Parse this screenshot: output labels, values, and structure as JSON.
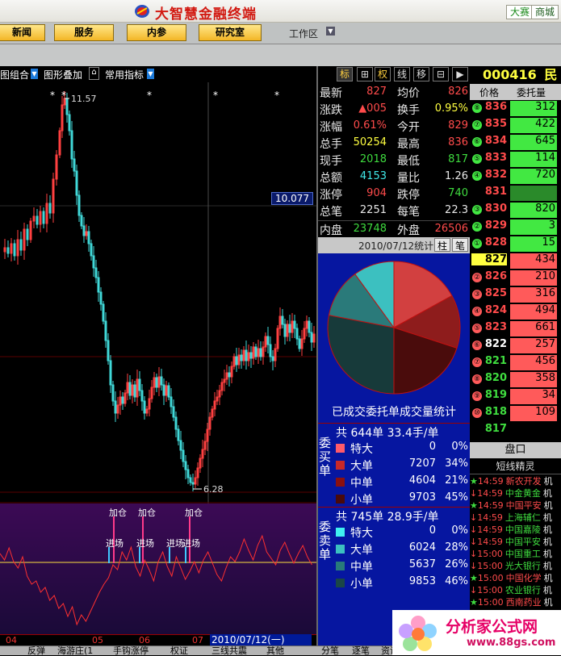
{
  "app": {
    "title": "大智慧金融终端",
    "btn_dasai": "大赛",
    "btn_shangcheng": "商城"
  },
  "menu": {
    "items": [
      "新闻",
      "服务",
      "内参",
      "研究室"
    ],
    "workzone": "工作区"
  },
  "toolbar": {
    "combo": "图组合",
    "overlay": "图形叠加",
    "indicator": "常用指标"
  },
  "chart": {
    "high_label": "11.57",
    "low_label": "6.28",
    "price_tag": "10.077",
    "signals": [
      "加仓",
      "加仓",
      "加仓",
      "进场",
      "进场",
      "进场",
      "进场"
    ],
    "x_ticks": [
      "04",
      "05",
      "06",
      "07"
    ],
    "date_label": "2010/07/12(一)"
  },
  "chart_data": {
    "type": "candlestick",
    "high": 11.57,
    "low": 6.28,
    "price_marker": 10.077,
    "x_labels": [
      "04",
      "05",
      "06",
      "07"
    ],
    "date": "2010/07/12(一)"
  },
  "bottom_tabs": [
    "反弹",
    "海游庄(1",
    "手钩涨停",
    "权证",
    "三线共震",
    "其他"
  ],
  "bottom_tabs_right": [
    "分笔",
    "逐笔",
    "资讯"
  ],
  "right_tools": [
    "标",
    "⊞",
    "权",
    "线",
    "移",
    "⊟",
    "▶"
  ],
  "stock": {
    "code": "000416",
    "name": "民生"
  },
  "quote": {
    "rows": [
      {
        "l": "最新",
        "v": "827",
        "vc": "red",
        "l2": "均价",
        "v2": "826",
        "v2c": "red"
      },
      {
        "l": "涨跌",
        "v": "▲005",
        "vc": "red",
        "l2": "换手",
        "v2": "0.95%",
        "v2c": "yellow"
      },
      {
        "l": "涨幅",
        "v": "0.61%",
        "vc": "red",
        "l2": "今开",
        "v2": "829",
        "v2c": "red"
      },
      {
        "l": "总手",
        "v": "50254",
        "vc": "yellow",
        "l2": "最高",
        "v2": "836",
        "v2c": "red"
      },
      {
        "l": "现手",
        "v": "2018",
        "vc": "green",
        "l2": "最低",
        "v2": "817",
        "v2c": "green"
      },
      {
        "l": "总额",
        "v": "4153",
        "vc": "cyan",
        "l2": "量比",
        "v2": "1.26",
        "v2c": "white"
      },
      {
        "l": "涨停",
        "v": "904",
        "vc": "red",
        "l2": "跌停",
        "v2": "740",
        "v2c": "green"
      },
      {
        "l": "总笔",
        "v": "2251",
        "vc": "white",
        "l2": "每笔",
        "v2": "22.3",
        "v2c": "white"
      }
    ],
    "neipan_label": "内盘",
    "neipan": "23748",
    "waipan_label": "外盘",
    "waipan": "26506"
  },
  "stats": {
    "header": "2010/07/12统计",
    "tab1": "柱",
    "tab2": "笔",
    "pie_title": "已成交委托单成交量统计"
  },
  "buy": {
    "vlabel": "委买单",
    "summary": "共 644单 33.4手/单",
    "rows": [
      {
        "n": "特大",
        "v": "0",
        "p": "0%",
        "c": "#ff5a6a"
      },
      {
        "n": "大单",
        "v": "7207",
        "p": "34%",
        "c": "#c82828"
      },
      {
        "n": "中单",
        "v": "4604",
        "p": "21%",
        "c": "#8a1010"
      },
      {
        "n": "小单",
        "v": "9703",
        "p": "45%",
        "c": "#4a0a0a"
      }
    ]
  },
  "sell": {
    "vlabel": "委卖单",
    "summary": "共 745单 28.9手/单",
    "rows": [
      {
        "n": "特大",
        "v": "0",
        "p": "0%",
        "c": "#40f0f0"
      },
      {
        "n": "大单",
        "v": "6024",
        "p": "28%",
        "c": "#3cc0c0"
      },
      {
        "n": "中单",
        "v": "5637",
        "p": "26%",
        "c": "#287a7a"
      },
      {
        "n": "小单",
        "v": "9853",
        "p": "46%",
        "c": "#1a4646"
      }
    ]
  },
  "pie": [
    {
      "name": "sell-small",
      "p": 0.46,
      "c": "#173a3a"
    },
    {
      "name": "sell-mid",
      "p": 0.26,
      "c": "#2a7a7a"
    },
    {
      "name": "sell-big",
      "p": 0.28,
      "c": "#3cc0c0"
    }
  ],
  "orderbook": {
    "head_price": "价格",
    "head_vol": "委托量",
    "rows": [
      {
        "c": "⑧",
        "p": "836",
        "v": "312",
        "pc": "#ff4b4b",
        "bg": "#42e842"
      },
      {
        "c": "⑦",
        "p": "835",
        "v": "422",
        "pc": "#ff4b4b",
        "bg": "#42e842"
      },
      {
        "c": "⑥",
        "p": "834",
        "v": "645",
        "pc": "#ff4b4b",
        "bg": "#42e842"
      },
      {
        "c": "⑤",
        "p": "833",
        "v": "114",
        "pc": "#ff4b4b",
        "bg": "#42e842"
      },
      {
        "c": "④",
        "p": "832",
        "v": "720",
        "pc": "#ff4b4b",
        "bg": "#42e842"
      },
      {
        "c": "",
        "p": "831",
        "v": "",
        "pc": "#ff4b4b",
        "bg": "#2a8a2a"
      },
      {
        "c": "③",
        "p": "830",
        "v": "820",
        "pc": "#ff4b4b",
        "bg": "#42e842"
      },
      {
        "c": "②",
        "p": "829",
        "v": "3",
        "pc": "#ff4b4b",
        "bg": "#42e842"
      },
      {
        "c": "①",
        "p": "828",
        "v": "15",
        "pc": "#ff4b4b",
        "bg": "#42e842"
      },
      {
        "c": "",
        "p": "827",
        "v": "434",
        "pc": "#000",
        "bg": "#ff5a5a",
        "hl": "#ffff40"
      },
      {
        "c": "②",
        "p": "826",
        "v": "210",
        "pc": "#ff4b4b",
        "bg": "#ff5a5a"
      },
      {
        "c": "③",
        "p": "825",
        "v": "316",
        "pc": "#ff4b4b",
        "bg": "#ff5a5a"
      },
      {
        "c": "④",
        "p": "824",
        "v": "494",
        "pc": "#ff4b4b",
        "bg": "#ff5a5a"
      },
      {
        "c": "⑤",
        "p": "823",
        "v": "661",
        "pc": "#ff4b4b",
        "bg": "#ff5a5a"
      },
      {
        "c": "⑥",
        "p": "822",
        "v": "257",
        "pc": "#ffffff",
        "bg": "#ff5a5a"
      },
      {
        "c": "⑦",
        "p": "821",
        "v": "456",
        "pc": "#3fdc3f",
        "bg": "#ff5a5a"
      },
      {
        "c": "⑧",
        "p": "820",
        "v": "358",
        "pc": "#3fdc3f",
        "bg": "#ff5a5a"
      },
      {
        "c": "⑨",
        "p": "819",
        "v": "34",
        "pc": "#3fdc3f",
        "bg": "#ff5a5a"
      },
      {
        "c": "⑩",
        "p": "818",
        "v": "109",
        "pc": "#3fdc3f",
        "bg": "#ff5a5a"
      },
      {
        "c": "",
        "p": "817",
        "v": "",
        "pc": "#3fdc3f",
        "bg": "#000"
      }
    ]
  },
  "pankou": "盘口",
  "elite": "短线精灵",
  "news": [
    {
      "s": "★",
      "t": "14:59",
      "n": "新农开发",
      "x": "机",
      "c": "#ff4b4b"
    },
    {
      "s": "↓",
      "t": "14:59",
      "n": "中金黄金",
      "x": "机",
      "c": "#3fdc3f"
    },
    {
      "s": "★",
      "t": "14:59",
      "n": "中国平安",
      "x": "机",
      "c": "#ff4b4b"
    },
    {
      "s": "↓",
      "t": "14:59",
      "n": "上海辅仁",
      "x": "机",
      "c": "#3fdc3f"
    },
    {
      "s": "↓",
      "t": "14:59",
      "n": "中国嘉陵",
      "x": "机",
      "c": "#3fdc3f"
    },
    {
      "s": "↓",
      "t": "14:59",
      "n": "中国平安",
      "x": "机",
      "c": "#3fdc3f"
    },
    {
      "s": "↓",
      "t": "15:00",
      "n": "中国重工",
      "x": "机",
      "c": "#3fdc3f"
    },
    {
      "s": "↓",
      "t": "15:00",
      "n": "光大银行",
      "x": "机",
      "c": "#3fdc3f"
    },
    {
      "s": "★",
      "t": "15:00",
      "n": "中国化学",
      "x": "机",
      "c": "#ff4b4b"
    },
    {
      "s": "↓",
      "t": "15:00",
      "n": "农业银行",
      "x": "机",
      "c": "#3fdc3f"
    },
    {
      "s": "★",
      "t": "15:00",
      "n": "西南药业",
      "x": "机",
      "c": "#ff4b4b"
    }
  ],
  "watermark": {
    "title": "分析家公式网",
    "url": "www.88gs.com"
  }
}
